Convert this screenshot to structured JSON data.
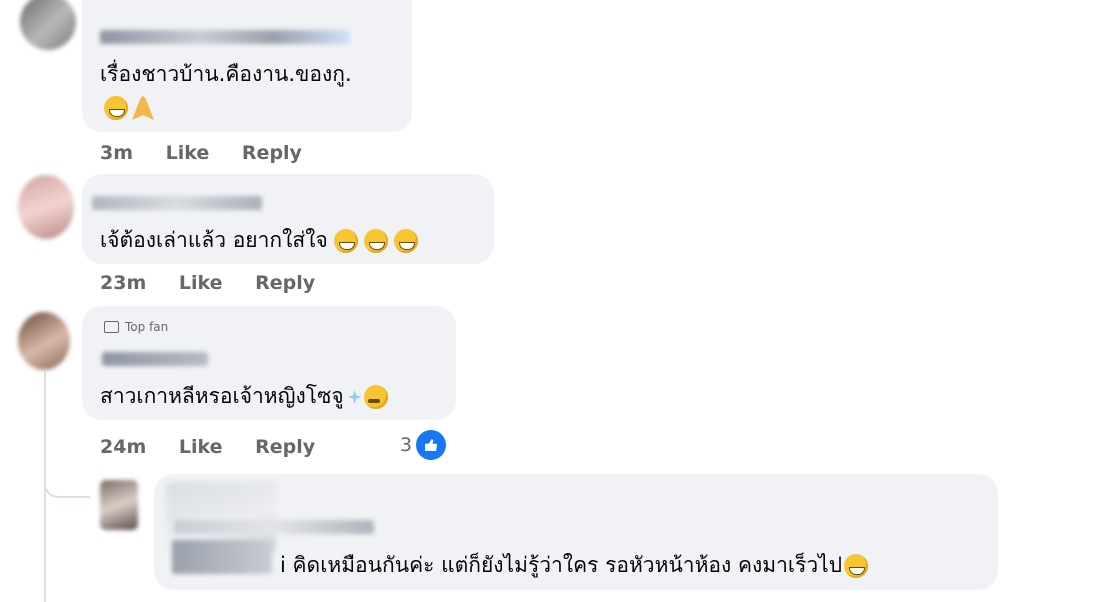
{
  "comments": [
    {
      "text": "เรื่องชาวบ้าน.คืองาน.ของกู.",
      "emojis": [
        "rolling-laughing-face",
        "folded-hands"
      ],
      "time": "3m",
      "like_label": "Like",
      "reply_label": "Reply"
    },
    {
      "text": "เจ้ต้องเล่าแล้ว อยากใส่ใจ",
      "emojis": [
        "grinning-face",
        "grinning-face",
        "grinning-face"
      ],
      "time": "23m",
      "like_label": "Like",
      "reply_label": "Reply"
    },
    {
      "badge": "Top fan",
      "text": "สาวเกาหลีหรอเจ้าหญิงโซจู",
      "emojis": [
        "sparkle",
        "thinking-face"
      ],
      "time": "24m",
      "like_label": "Like",
      "reply_label": "Reply",
      "reaction_count": "3",
      "reaction_icon": "like-icon"
    },
    {
      "text": "i คิดเหมือนกันค่ะ แต่ก็ยังไม่รู้ว่าใคร รอหัวหน้าห้อง คงมาเร็วไป",
      "emojis": [
        "grinning-sweat-face"
      ]
    }
  ],
  "colors": {
    "bubble": "#f0f2f5",
    "meta": "#65676b",
    "like_blue": "#1877f2"
  }
}
